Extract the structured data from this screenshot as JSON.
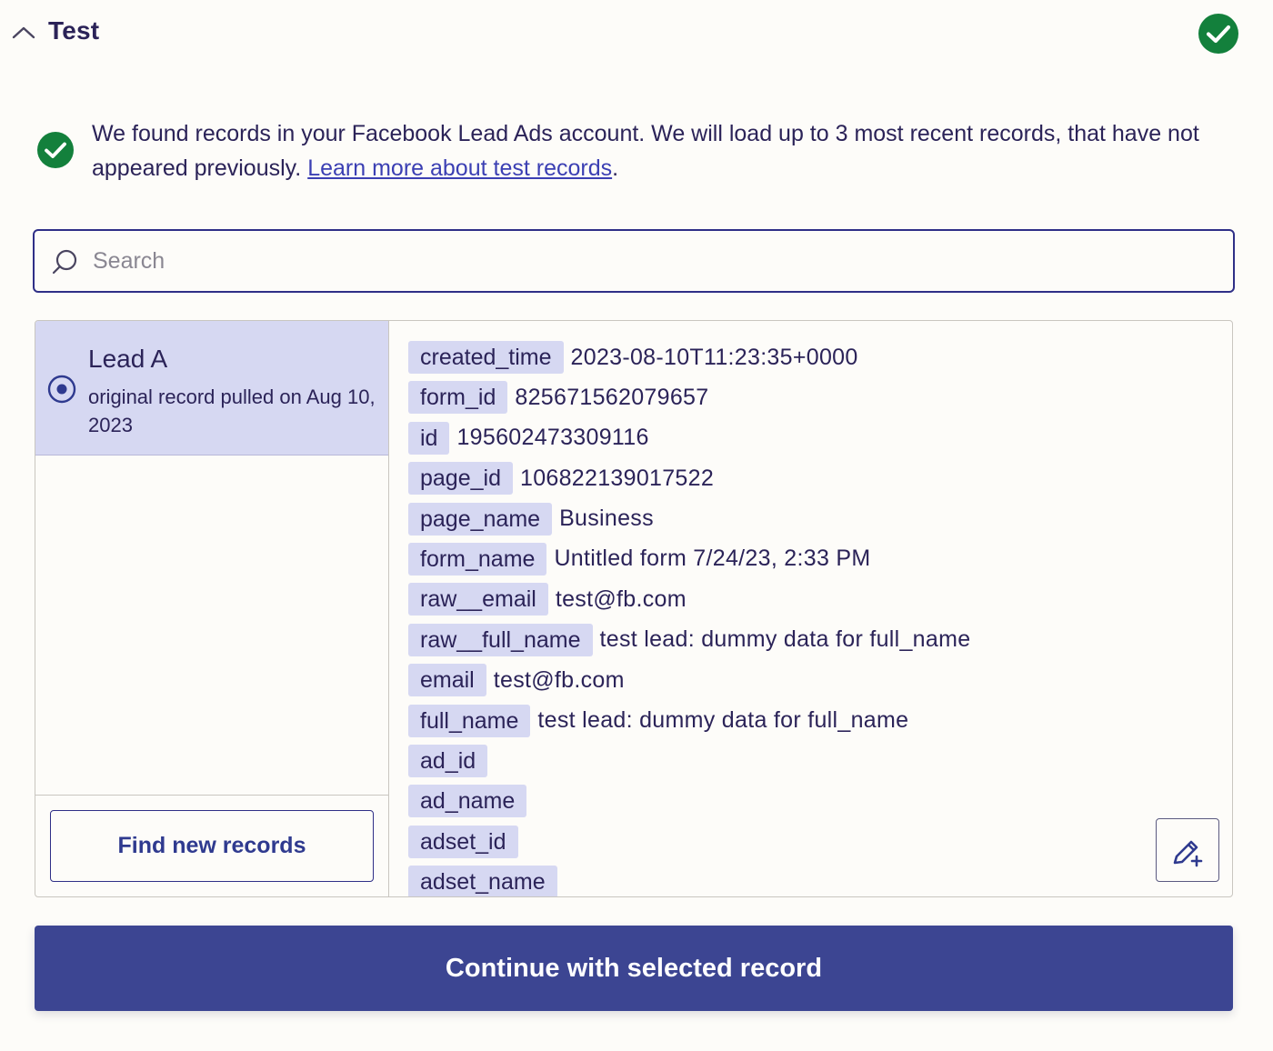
{
  "header": {
    "title": "Test"
  },
  "info": {
    "message": "We found records in your Facebook Lead Ads account. We will load up to 3 most recent records, that have not appeared previously.",
    "link_text": "Learn more about test records",
    "trailing": "."
  },
  "search": {
    "placeholder": "Search",
    "value": ""
  },
  "records": {
    "items": [
      {
        "title": "Lead A",
        "subtitle": "original record pulled on Aug 10, 2023",
        "selected": true
      }
    ],
    "find_button": "Find new records"
  },
  "fields": [
    {
      "key": "created_time",
      "value": "2023-08-10T11:23:35+0000"
    },
    {
      "key": "form_id",
      "value": "825671562079657"
    },
    {
      "key": "id",
      "value": "195602473309116"
    },
    {
      "key": "page_id",
      "value": "106822139017522"
    },
    {
      "key": "page_name",
      "value": "Business"
    },
    {
      "key": "form_name",
      "value": "Untitled form 7/24/23, 2:33 PM"
    },
    {
      "key": "raw__email",
      "value": "test@fb.com"
    },
    {
      "key": "raw__full_name",
      "value": "test lead: dummy data for full_name"
    },
    {
      "key": "email",
      "value": "test@fb.com"
    },
    {
      "key": "full_name",
      "value": "test lead: dummy data for full_name"
    },
    {
      "key": "ad_id",
      "value": ""
    },
    {
      "key": "ad_name",
      "value": ""
    },
    {
      "key": "adset_id",
      "value": ""
    },
    {
      "key": "adset_name",
      "value": ""
    }
  ],
  "continue_button": "Continue with selected record",
  "colors": {
    "primary": "#3c4592",
    "success": "#13803c",
    "selected_bg": "#d6d8f2",
    "background": "#fdfcf9"
  }
}
